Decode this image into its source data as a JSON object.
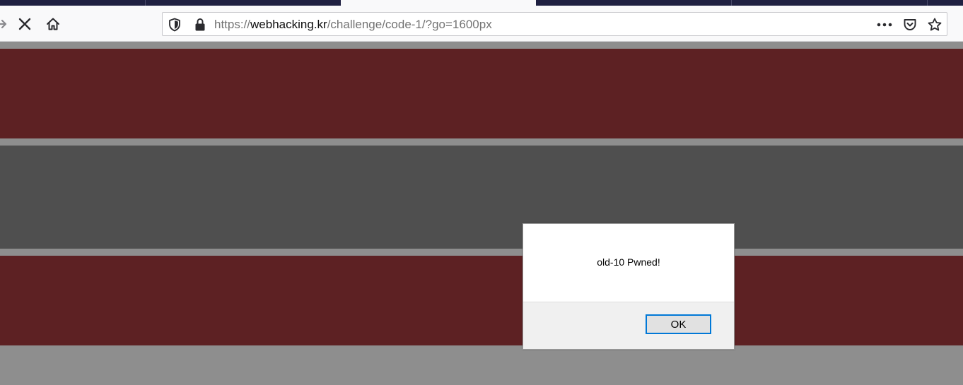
{
  "browser": {
    "url": {
      "scheme": "https://",
      "domain": "webhacking.kr",
      "path": "/challenge/code-1/?go=1600px"
    },
    "icons": {
      "back": "back-arrow-icon",
      "stop": "close-icon",
      "home": "home-icon",
      "tracking": "shield-icon",
      "secure": "lock-icon",
      "more": "ellipsis-icon",
      "pocket": "pocket-icon",
      "bookmark": "star-icon"
    }
  },
  "page": {
    "colors": {
      "stripe_red": "#5d2123",
      "stripe_gray": "#4f4f4f",
      "background": "#8e8e8e",
      "tab_dark": "#1f2041"
    }
  },
  "dialog": {
    "message": "old-10 Pwned!",
    "ok_label": "OK"
  }
}
